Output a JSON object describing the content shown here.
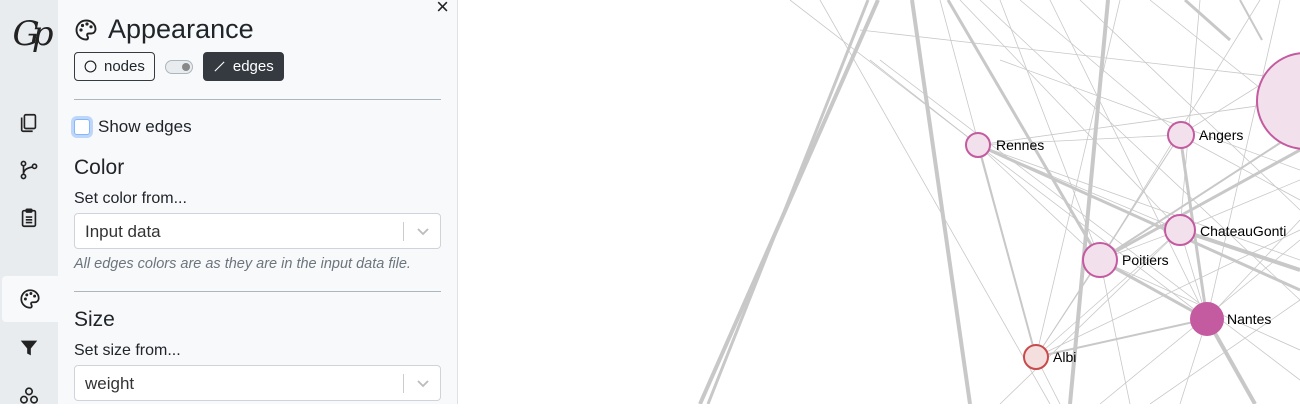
{
  "sidebar": {
    "logo": "Gp",
    "items": [
      {
        "name": "file-icon",
        "label": "File"
      },
      {
        "name": "graph-icon",
        "label": "Graph"
      },
      {
        "name": "clipboard-icon",
        "label": "Data"
      },
      {
        "name": "palette-icon",
        "label": "Appearance",
        "active": true
      },
      {
        "name": "filter-icon",
        "label": "Filters"
      },
      {
        "name": "community-icon",
        "label": "Statistics"
      }
    ]
  },
  "panel": {
    "title": "Appearance",
    "close": "×",
    "toggle": {
      "nodes_label": "nodes",
      "edges_label": "edges",
      "selected": "edges"
    },
    "show_edges_label": "Show edges",
    "show_edges_checked": false,
    "color": {
      "title": "Color",
      "set_from_label": "Set color from...",
      "selected": "Input data",
      "hint": "All edges colors are as they are in the input data file."
    },
    "size": {
      "title": "Size",
      "set_from_label": "Set size from...",
      "selected": "weight"
    }
  },
  "graph": {
    "nodes": [
      {
        "label": "Rennes",
        "color": "#c45aa0",
        "fill": "#f2e0ec"
      },
      {
        "label": "Angers",
        "color": "#c45aa0",
        "fill": "#f2e0ec"
      },
      {
        "label": "ChateauGonti",
        "color": "#c45aa0",
        "fill": "#f2e0ec"
      },
      {
        "label": "Poitiers",
        "color": "#c45aa0",
        "fill": "#f2e0ec"
      },
      {
        "label": "Nantes",
        "color": "#c45aa0",
        "fill": "#c45aa0"
      },
      {
        "label": "Albi",
        "color": "#c84a4a",
        "fill": "#f5dede"
      },
      {
        "label": "",
        "color": "#c45aa0",
        "fill": "#f2e0ec"
      }
    ],
    "edge_color": "#c8c8c8"
  }
}
